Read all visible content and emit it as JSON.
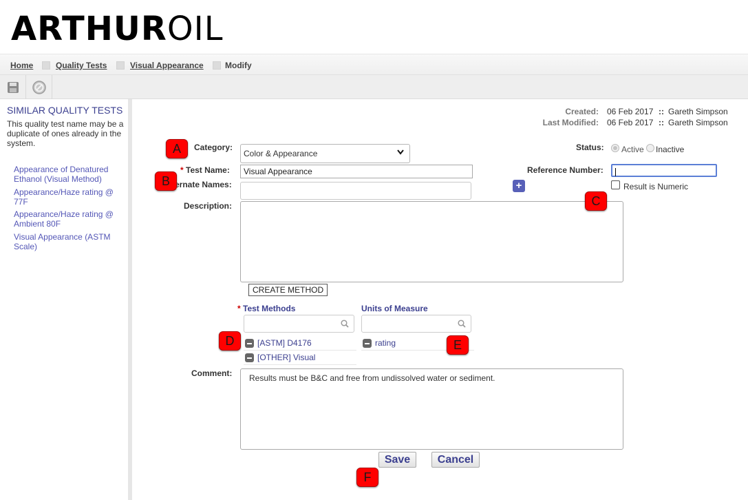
{
  "brand": {
    "bold": "ARTHUR",
    "light": "OIL"
  },
  "breadcrumb": [
    {
      "label": "Home"
    },
    {
      "label": "Quality Tests"
    },
    {
      "label": "Visual Appearance"
    },
    {
      "label": "Modify"
    }
  ],
  "sidebar": {
    "title": "SIMILAR QUALITY TESTS",
    "description": "This quality test name may be a duplicate of ones already in the system.",
    "links": [
      "Appearance of Denatured Ethanol (Visual Method)",
      "Appearance/Haze rating @ 77F",
      "Appearance/Haze rating @ Ambient 80F",
      "Visual Appearance (ASTM Scale)"
    ]
  },
  "meta": {
    "created_label": "Created:",
    "created_date": "06 Feb 2017",
    "created_by": "Gareth Simpson",
    "modified_label": "Last Modified:",
    "modified_date": "06 Feb 2017",
    "modified_by": "Gareth Simpson",
    "sep": "::"
  },
  "form": {
    "category_label": "Category:",
    "category_value": "Color & Appearance",
    "test_name_label": "Test Name:",
    "test_name_value": "Visual Appearance",
    "alternate_names_label": "ernate Names:",
    "alternate_names_value": "",
    "description_label": "Description:",
    "description_value": "",
    "status_label": "Status:",
    "status_active": "Active",
    "status_inactive": "Inactive",
    "reference_label": "Reference Number:",
    "reference_value": "",
    "result_numeric_label": "Result is Numeric",
    "create_method_label": "CREATE METHOD",
    "test_methods_label": "Test Methods",
    "units_label": "Units of Measure",
    "test_methods": [
      "[ASTM] D4176",
      "[OTHER] Visual"
    ],
    "units": [
      "rating"
    ],
    "comment_label": "Comment:",
    "comment_value": "Results must be B&C and free from undissolved water or sediment.",
    "save_label": "Save",
    "cancel_label": "Cancel",
    "required_mark": "*"
  },
  "callouts": [
    "A",
    "B",
    "C",
    "D",
    "E",
    "F"
  ]
}
